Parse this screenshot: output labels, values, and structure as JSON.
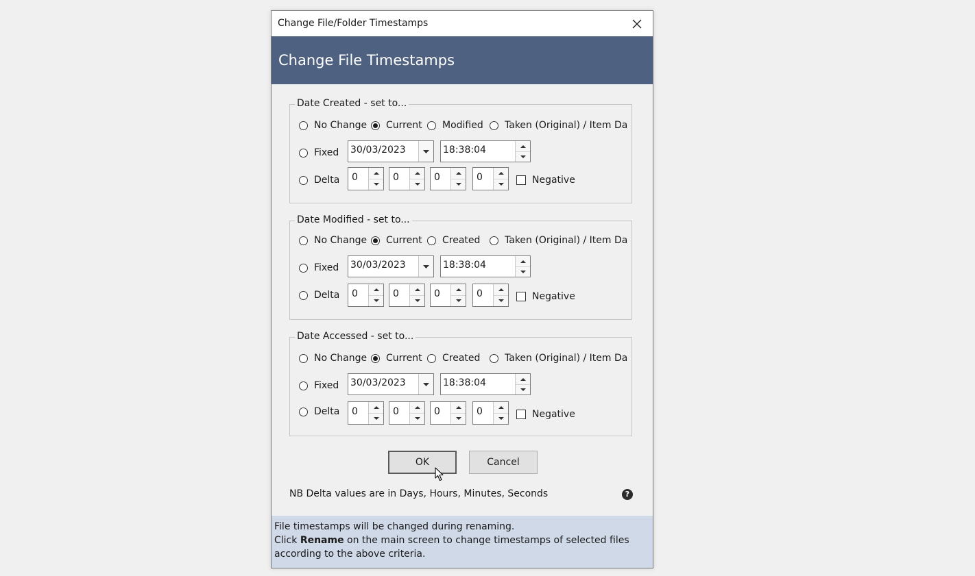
{
  "window": {
    "title": "Change File/Folder Timestamps"
  },
  "banner": {
    "title": "Change File Timestamps"
  },
  "groups": [
    {
      "legend": "Date Created - set to...",
      "options": [
        "No Change",
        "Current",
        "Modified",
        "Taken (Original) / Item Date"
      ],
      "selected": "Current",
      "fixed_label": "Fixed",
      "fixed_date": "30/03/2023",
      "fixed_time": "18:38:04",
      "delta_label": "Delta",
      "delta_values": [
        "0",
        "0",
        "0",
        "0"
      ],
      "negative_label": "Negative",
      "negative_checked": false
    },
    {
      "legend": "Date Modified - set to...",
      "options": [
        "No Change",
        "Current",
        "Created",
        "Taken (Original) / Item Date"
      ],
      "selected": "Current",
      "fixed_label": "Fixed",
      "fixed_date": "30/03/2023",
      "fixed_time": "18:38:04",
      "delta_label": "Delta",
      "delta_values": [
        "0",
        "0",
        "0",
        "0"
      ],
      "negative_label": "Negative",
      "negative_checked": false
    },
    {
      "legend": "Date Accessed - set to...",
      "options": [
        "No Change",
        "Current",
        "Created",
        "Taken (Original) / Item Date"
      ],
      "selected": "Current",
      "fixed_label": "Fixed",
      "fixed_date": "30/03/2023",
      "fixed_time": "18:38:04",
      "delta_label": "Delta",
      "delta_values": [
        "0",
        "0",
        "0",
        "0"
      ],
      "negative_label": "Negative",
      "negative_checked": false
    }
  ],
  "buttons": {
    "ok": "OK",
    "cancel": "Cancel"
  },
  "note": "NB Delta values are in Days, Hours, Minutes, Seconds",
  "help_icon_glyph": "?",
  "info": {
    "line1": "File timestamps will be changed during renaming.",
    "line2_prefix": "Click ",
    "line2_bold": "Rename",
    "line2_suffix": " on the main screen to change timestamps of selected files",
    "line3": "according to the above criteria."
  },
  "colors": {
    "banner_bg": "#4e6180",
    "info_bg": "#d0d9e8",
    "dialog_bg": "#f0f0f0"
  },
  "icons": {
    "close": "close-icon",
    "dropdown": "chevron-down-icon",
    "help": "help-icon",
    "cursor": "mouse-cursor-icon"
  }
}
